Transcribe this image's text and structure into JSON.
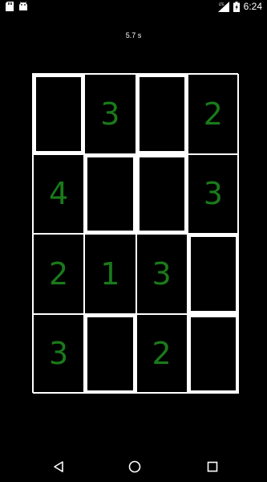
{
  "status_bar": {
    "time": "6:24",
    "icons": [
      "sd-card-icon",
      "android-icon",
      "signal-lte-icon",
      "battery-charging-icon"
    ]
  },
  "game": {
    "timer": "5.7 s",
    "digit_color": "#1a7a1a",
    "grid": [
      [
        {
          "value": "",
          "bold": true
        },
        {
          "value": "3",
          "bold": false
        },
        {
          "value": "",
          "bold": true
        },
        {
          "value": "2",
          "bold": false
        }
      ],
      [
        {
          "value": "4",
          "bold": false
        },
        {
          "value": "",
          "bold": true
        },
        {
          "value": "",
          "bold": true
        },
        {
          "value": "3",
          "bold": false
        }
      ],
      [
        {
          "value": "2",
          "bold": false
        },
        {
          "value": "1",
          "bold": false
        },
        {
          "value": "3",
          "bold": false
        },
        {
          "value": "",
          "bold": true
        }
      ],
      [
        {
          "value": "3",
          "bold": false
        },
        {
          "value": "",
          "bold": true
        },
        {
          "value": "2",
          "bold": false
        },
        {
          "value": "",
          "bold": true
        }
      ]
    ]
  },
  "nav_bar": {
    "icons": [
      "back-icon",
      "home-icon",
      "recents-icon"
    ]
  }
}
